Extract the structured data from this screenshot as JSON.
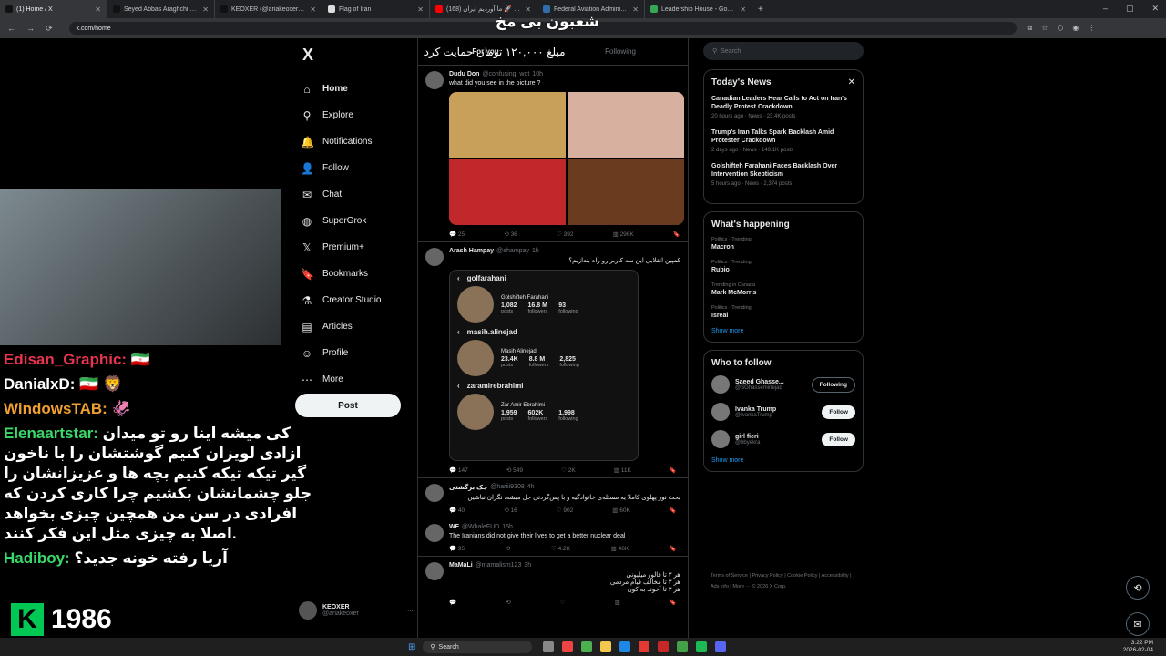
{
  "browser": {
    "tabs": [
      {
        "title": "(1) Home / X",
        "color": "#111111"
      },
      {
        "title": "Seyed Abbas Araghchi on X: \"M",
        "color": "#111111"
      },
      {
        "title": "KEOXER (@ariakeoxer) / X",
        "color": "#111111"
      },
      {
        "title": "Flag of Iran",
        "color": "#dddddd"
      },
      {
        "title": "(168) هواپیما 🚀 ما آوردیم ایران",
        "color": "#ff0000"
      },
      {
        "title": "Federal Aviation Administratic",
        "color": "#2f6ea8"
      },
      {
        "title": "Leadership House - Google M",
        "color": "#34a853"
      }
    ],
    "url": "x.com/home"
  },
  "sidebar": {
    "logo": "X",
    "items": [
      {
        "label": "Home",
        "icon": "home-icon",
        "glyph": "⌂"
      },
      {
        "label": "Explore",
        "icon": "search-icon",
        "glyph": "⚲"
      },
      {
        "label": "Notifications",
        "icon": "bell-icon",
        "glyph": "🔔"
      },
      {
        "label": "Follow",
        "icon": "person-add-icon",
        "glyph": "👤"
      },
      {
        "label": "Chat",
        "icon": "mail-icon",
        "glyph": "✉"
      },
      {
        "label": "SuperGrok",
        "icon": "grok-icon",
        "glyph": "◍"
      },
      {
        "label": "Premium+",
        "icon": "x-icon",
        "glyph": "𝕏"
      },
      {
        "label": "Bookmarks",
        "icon": "bookmark-icon",
        "glyph": "🔖"
      },
      {
        "label": "Creator Studio",
        "icon": "flask-icon",
        "glyph": "⚗"
      },
      {
        "label": "Articles",
        "icon": "article-icon",
        "glyph": "▤"
      },
      {
        "label": "Profile",
        "icon": "user-icon",
        "glyph": "☺"
      },
      {
        "label": "More",
        "icon": "more-icon",
        "glyph": "⋯"
      }
    ],
    "post_label": "Post",
    "account": {
      "name": "KEOXER",
      "handle": "@ariakeoxer"
    }
  },
  "feed": {
    "tabs": [
      "For you",
      "Following"
    ],
    "tweets": [
      {
        "name": "Dudu Don",
        "handle": "@confusing_wot",
        "time": "10h",
        "text": "what did you see in the picture ?",
        "stats": {
          "replies": "25",
          "retweets": "36",
          "likes": "392",
          "views": "296K"
        }
      },
      {
        "name": "Arash Hampay",
        "handle": "@ahampay",
        "time": "1h",
        "text": "کمپین انقلابی این سه کاربر رو راه بندازیم؟",
        "profiles": [
          {
            "username": "golfarahani",
            "display": "Golshifteh Farahani",
            "posts": "1,082",
            "followers": "16.8 M",
            "following": "93"
          },
          {
            "username": "masih.alinejad",
            "display": "Masih Alinejad",
            "posts": "23.4K",
            "followers": "8.8 M",
            "following": "2,825"
          },
          {
            "username": "zaramirebrahimi",
            "display": "Zar Amir Ebrahimi",
            "posts": "1,959",
            "followers": "602K",
            "following": "1,998"
          }
        ],
        "stat_labels": {
          "posts": "posts",
          "followers": "followers",
          "following": "following"
        },
        "stats": {
          "replies": "147",
          "retweets": "549",
          "likes": "2K",
          "views": "11K"
        }
      },
      {
        "name": "جک برگشتی",
        "handle": "@hariii9308",
        "time": "4h",
        "text": "بحث نور پهلوی کاملا یه مسئله‌ی خانوادگیه و با پس‌گردنی حل میشه، نگران نباشین",
        "stats": {
          "replies": "40",
          "retweets": "16",
          "likes": "902",
          "views": "60K"
        }
      },
      {
        "name": "WF",
        "handle": "@WhaleFUD",
        "time": "15h",
        "text": "The Iranians did not give their lives to get a better nuclear deal",
        "stats": {
          "replies": "95",
          "retweets": "",
          "likes": "4.2K",
          "views": "46K"
        }
      },
      {
        "name": "MaMaLi",
        "handle": "@mamalism123",
        "time": "3h",
        "text": "هر ۳ تا فالور میلیونی\nهر ۳ تا مخالف قیام مردمی\nهر ۳ تا آخوند به کون",
        "stats": {
          "replies": "",
          "retweets": "",
          "likes": "",
          "views": ""
        }
      }
    ]
  },
  "right": {
    "search_placeholder": "Search",
    "todays_news": {
      "title": "Today's News",
      "items": [
        {
          "headline": "Canadian Leaders Hear Calls to Act on Iran's Deadly Protest Crackdown",
          "meta": "20 hours ago · News · 23.4K posts"
        },
        {
          "headline": "Trump's Iran Talks Spark Backlash Amid Protester Crackdown",
          "meta": "2 days ago · News · 149.1K posts"
        },
        {
          "headline": "Golshifteh Farahani Faces Backlash Over Intervention Skepticism",
          "meta": "5 hours ago · News · 2,374 posts"
        }
      ]
    },
    "whats_happening": {
      "title": "What's happening",
      "trends": [
        {
          "context": "Politics · Trending",
          "name": "Macron"
        },
        {
          "context": "Politics · Trending",
          "name": "Rubio"
        },
        {
          "context": "Trending in Canada",
          "name": "Mark McMorris"
        },
        {
          "context": "Politics · Trending",
          "name": "Isreal"
        }
      ],
      "show_more": "Show more"
    },
    "who_to_follow": {
      "title": "Who to follow",
      "people": [
        {
          "name": "Saeed Ghasse...",
          "handle": "@SGhasseminejad",
          "button": "Following"
        },
        {
          "name": "Ivanka Trump",
          "handle": "@IvankaTrump",
          "button": "Follow"
        },
        {
          "name": "girl fieri",
          "handle": "@bbyekra",
          "button": "Follow"
        }
      ],
      "show_more": "Show more"
    },
    "footer": "Terms of Service | Privacy Policy | Cookie Policy | Accessibility | Ads info | More ··· © 2026 X Corp."
  },
  "overlay": {
    "donation_title": "شعبون بی مخ",
    "donation_text": "مبلغ ۱۲۰,۰۰۰ تومان حمایت کرد",
    "chat": [
      {
        "user": "Edisan_Graphic:",
        "message": "🇮🇷",
        "color": "#e8344e"
      },
      {
        "user": "DanialxD:",
        "message": "🇮🇷 🦁",
        "color": "#ffffff"
      },
      {
        "user": "WindowsTAB:",
        "message": "🦑",
        "color": "#f0a030"
      },
      {
        "user": "Elenaartstar:",
        "message": "کی میشه اینا رو تو میدان ازادی لویزان کنیم گوشتشان را با ناخون گیر تیکه تیکه کنیم بچه ها و عزیزانشان را جلو چشمانشان بکشیم چرا کاری کردن که افرادی در سن من همچین چیزی بخواهد اصلا به چیزی مثل این فکر کنند.",
        "color": "#3ad86a"
      },
      {
        "user": "Hadiboy:",
        "message": "آریا رفته خونه جدید؟",
        "color": "#3ad86a"
      }
    ],
    "brand_letter": "K",
    "brand_number": "1986"
  },
  "taskbar": {
    "search": "Search",
    "time": "3:22 PM",
    "date": "2026-02-04"
  }
}
